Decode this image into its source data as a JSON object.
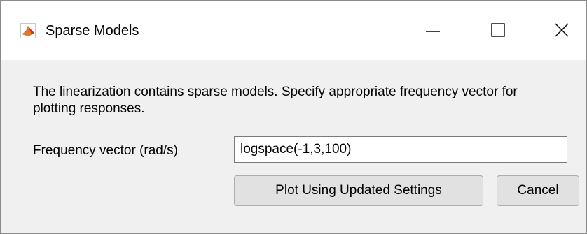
{
  "window": {
    "title": "Sparse Models",
    "icon": "matlab-logo-icon",
    "controls": {
      "minimize": "minimize-icon",
      "maximize": "maximize-icon",
      "close": "close-icon"
    }
  },
  "dialog": {
    "message": "The linearization contains sparse models. Specify appropriate frequency vector for plotting responses.",
    "frequency_label": "Frequency vector (rad/s)",
    "frequency_value": "logspace(-1,3,100)",
    "plot_button_label": "Plot Using Updated Settings",
    "cancel_button_label": "Cancel"
  },
  "colors": {
    "titlebar": "#ffffff",
    "dialog_background": "#f0f0f0",
    "button_background": "#e1e1e1",
    "button_border": "#adadad"
  }
}
